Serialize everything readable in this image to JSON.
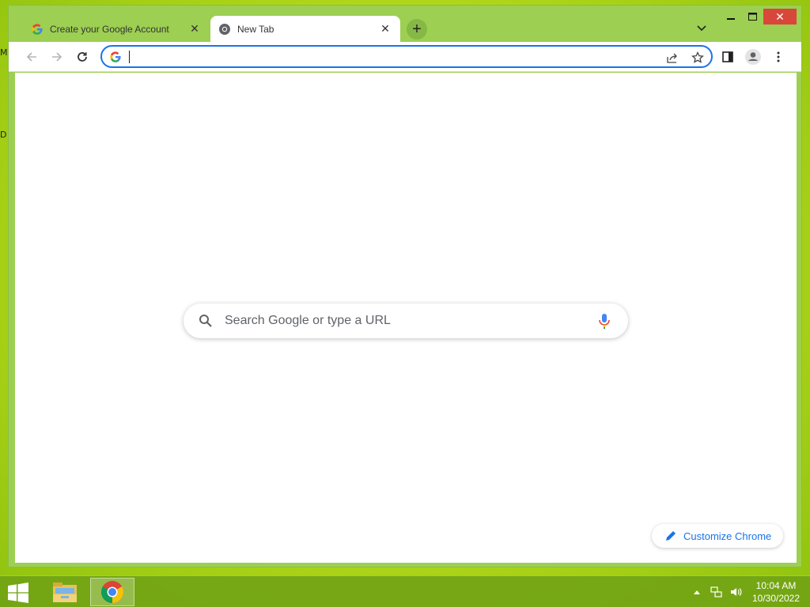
{
  "desktop": {
    "edge_text_1": "M",
    "edge_text_2": "D"
  },
  "browser": {
    "tabs": [
      {
        "title": "Create your Google Account",
        "favicon": "google-g-icon",
        "active": false
      },
      {
        "title": "New Tab",
        "favicon": "chrome-icon",
        "active": true
      }
    ],
    "new_tab_icon": "plus-icon",
    "window_controls": {
      "minimize": "–",
      "maximize": "☐",
      "close": "✕"
    },
    "toolbar": {
      "back": "back-arrow-icon",
      "forward": "forward-arrow-icon",
      "reload": "reload-icon",
      "omnibox_value": "",
      "share": "share-icon",
      "bookmark": "star-icon",
      "side_panel": "side-panel-icon",
      "profile": "profile-icon",
      "menu": "more-vertical-icon"
    },
    "ntp": {
      "search_placeholder": "Search Google or type a URL",
      "customize_label": "Customize Chrome"
    },
    "colors": {
      "accent": "#1a73e8",
      "frame": "#9ccf52",
      "close_button": "#d9463a"
    }
  },
  "taskbar": {
    "apps": [
      "windows-start-icon",
      "file-explorer-icon",
      "chrome-icon"
    ],
    "tray_icons": [
      "show-hidden-icons-arrow",
      "network-icon",
      "volume-icon"
    ],
    "time": "10:04 AM",
    "date": "10/30/2022"
  }
}
